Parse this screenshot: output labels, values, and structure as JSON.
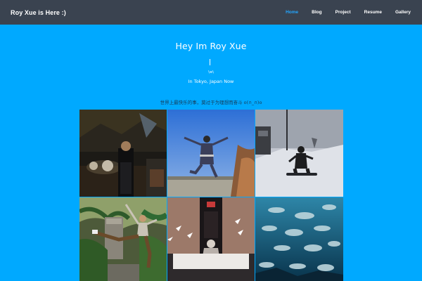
{
  "site": {
    "brand": "Roy Xue is Here :)"
  },
  "nav": {
    "items": [
      "Home",
      "Blog",
      "Project",
      "Resume",
      "Gallery"
    ],
    "active": "Home"
  },
  "hero": {
    "title": "Hey Im Roy Xue",
    "face": "\\w\\",
    "location": "In Tokyo, Japan Now",
    "quote": "世界上最快乐的事，莫过于为理想而奋斗 o(∩_∩)o"
  },
  "gallery": {
    "photos": [
      "night-street-photo",
      "jump-photo",
      "snowboard-photo",
      "garden-pose-photo",
      "exhibit-photo",
      "aquarium-photo"
    ]
  },
  "colors": {
    "background": "#00a9ff",
    "navbar": "#3a4350",
    "nav_active": "#23a6ff"
  }
}
